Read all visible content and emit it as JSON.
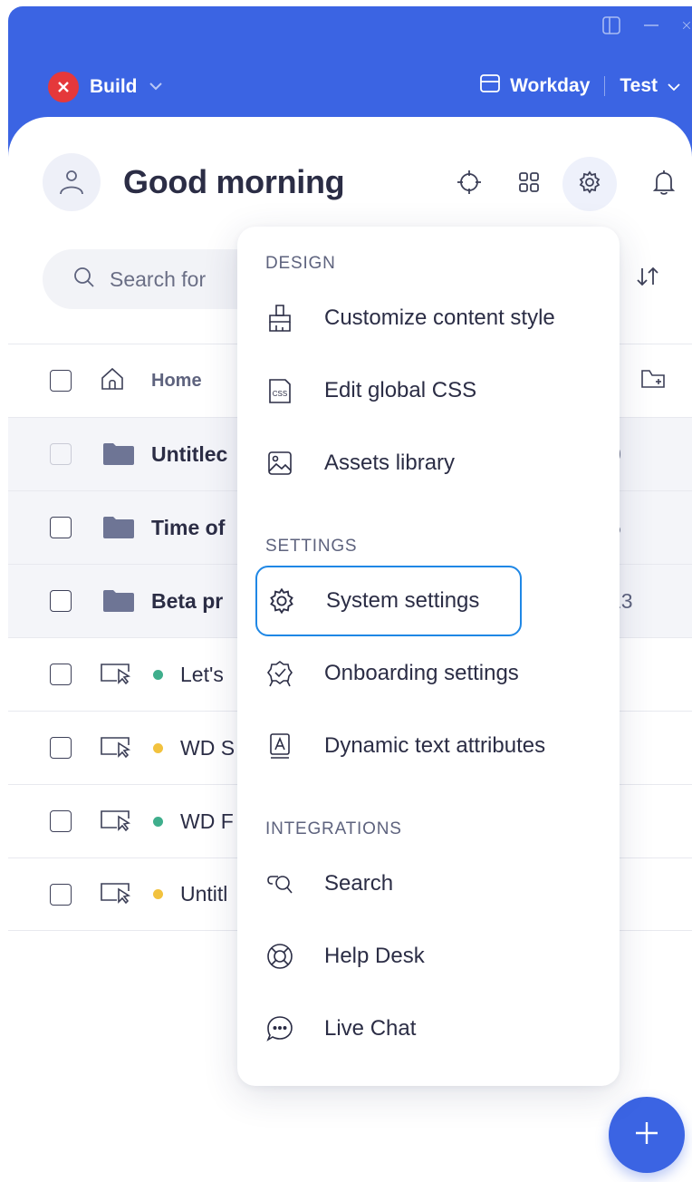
{
  "header": {
    "build_label": "Build",
    "env_label": "Workday",
    "env_mode": "Test"
  },
  "greeting": "Good morning",
  "search": {
    "placeholder": "Search for"
  },
  "list": {
    "home_label": "Home",
    "items": [
      {
        "type": "folder",
        "label": "Untitlec",
        "count": "0"
      },
      {
        "type": "folder",
        "label": "Time of",
        "count": "5"
      },
      {
        "type": "folder",
        "label": "Beta pr",
        "count": "13"
      },
      {
        "type": "flow",
        "label": "Let's",
        "status_color": "#3fae8c"
      },
      {
        "type": "flow",
        "label": "WD S",
        "status_color": "#f2c23e"
      },
      {
        "type": "flow",
        "label": "WD F",
        "status_color": "#3fae8c"
      },
      {
        "type": "flow",
        "label": "Untitl",
        "status_color": "#f2c23e"
      }
    ]
  },
  "menu": {
    "design_title": "DESIGN",
    "design_items": [
      {
        "label": "Customize content style",
        "icon": "paint-brush-icon"
      },
      {
        "label": "Edit global CSS",
        "icon": "css-file-icon"
      },
      {
        "label": "Assets library",
        "icon": "image-icon"
      }
    ],
    "settings_title": "SETTINGS",
    "settings_items": [
      {
        "label": "System settings",
        "icon": "gear-icon"
      },
      {
        "label": "Onboarding settings",
        "icon": "badge-check-icon"
      },
      {
        "label": "Dynamic text attributes",
        "icon": "text-attribute-icon"
      }
    ],
    "integrations_title": "INTEGRATIONS",
    "integrations_items": [
      {
        "label": "Search",
        "icon": "search-chat-icon"
      },
      {
        "label": "Help Desk",
        "icon": "lifebuoy-icon"
      },
      {
        "label": "Live Chat",
        "icon": "chat-bubble-icon"
      }
    ]
  },
  "colors": {
    "brand": "#3b64e3",
    "focus_ring": "#1f87e5",
    "close_red": "#e5383b",
    "folder": "#6e7595"
  }
}
